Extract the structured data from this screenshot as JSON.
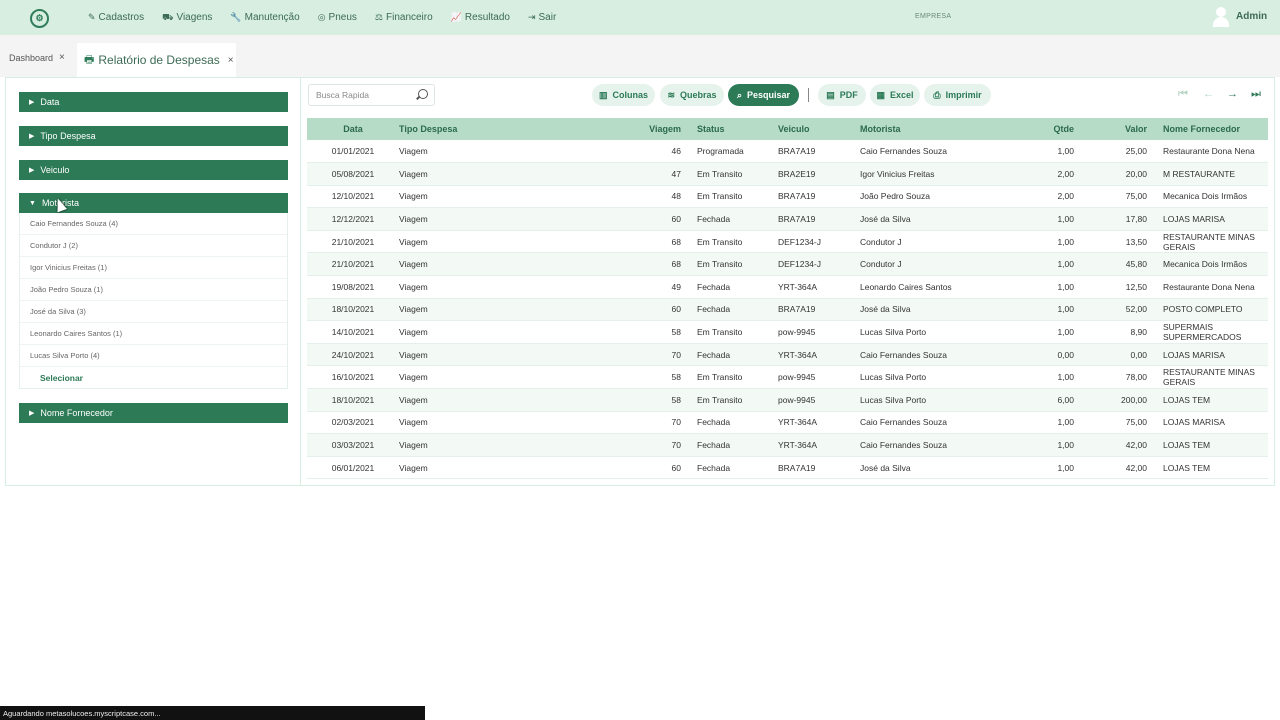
{
  "nav": {
    "logo": "⚙",
    "items": [
      {
        "icon": "✎",
        "icon_name": "edit-icon",
        "label": "Cadastros"
      },
      {
        "icon": "⛟",
        "icon_name": "truck-icon",
        "label": "Viagens"
      },
      {
        "icon": "🔧",
        "icon_name": "wrench-icon",
        "label": "Manutenção"
      },
      {
        "icon": "◎",
        "icon_name": "tire-icon",
        "label": "Pneus"
      },
      {
        "icon": "⚖",
        "icon_name": "money-icon",
        "label": "Financeiro"
      },
      {
        "icon": "📈",
        "icon_name": "chart-icon",
        "label": "Resultado"
      },
      {
        "icon": "⇥",
        "icon_name": "logout-icon",
        "label": "Sair"
      }
    ],
    "empresa": "EMPRESA",
    "user": "Admin"
  },
  "tabs": {
    "dashboard": "Dashboard",
    "active": "Relatório de Despesas",
    "close": "×"
  },
  "filters": {
    "data": "Data",
    "tipo": "Tipo Despesa",
    "veiculo": "Veiculo",
    "motorista": "Motorista",
    "fornecedor": "Nome Fornecedor",
    "motoristas": [
      "Caio Fernandes Souza (4)",
      "Condutor J (2)",
      "Igor Vinicius Freitas (1)",
      "João Pedro Souza (1)",
      "José da Silva (3)",
      "Leonardo Caires Santos (1)",
      "Lucas Silva Porto (4)"
    ],
    "selecionar": "Selecionar"
  },
  "toolbar": {
    "search_placeholder": "Busca Rapida",
    "colunas": "Colunas",
    "quebras": "Quebras",
    "pesquisar": "Pesquisar",
    "pdf": "PDF",
    "excel": "Excel",
    "imprimir": "Imprimir"
  },
  "table": {
    "headers": [
      "Data",
      "Tipo Despesa",
      "Viagem",
      "Status",
      "Veiculo",
      "Motorista",
      "Qtde",
      "Valor",
      "Nome Fornecedor"
    ],
    "rows": [
      [
        "01/01/2021",
        "Viagem",
        "46",
        "Programada",
        "BRA7A19",
        "Caio Fernandes Souza",
        "1,00",
        "25,00",
        "Restaurante Dona Nena"
      ],
      [
        "05/08/2021",
        "Viagem",
        "47",
        "Em Transito",
        "BRA2E19",
        "Igor Vinicius Freitas",
        "2,00",
        "20,00",
        "M RESTAURANTE"
      ],
      [
        "12/10/2021",
        "Viagem",
        "48",
        "Em Transito",
        "BRA7A19",
        "João Pedro Souza",
        "2,00",
        "75,00",
        "Mecanica Dois Irmãos"
      ],
      [
        "12/12/2021",
        "Viagem",
        "60",
        "Fechada",
        "BRA7A19",
        "José da Silva",
        "1,00",
        "17,80",
        "LOJAS MARISA"
      ],
      [
        "21/10/2021",
        "Viagem",
        "68",
        "Em Transito",
        "DEF1234-J",
        "Condutor J",
        "1,00",
        "13,50",
        "RESTAURANTE MINAS GERAIS"
      ],
      [
        "21/10/2021",
        "Viagem",
        "68",
        "Em Transito",
        "DEF1234-J",
        "Condutor J",
        "1,00",
        "45,80",
        "Mecanica Dois Irmãos"
      ],
      [
        "19/08/2021",
        "Viagem",
        "49",
        "Fechada",
        "YRT-364A",
        "Leonardo Caires Santos",
        "1,00",
        "12,50",
        "Restaurante Dona Nena"
      ],
      [
        "18/10/2021",
        "Viagem",
        "60",
        "Fechada",
        "BRA7A19",
        "José da Silva",
        "1,00",
        "52,00",
        "POSTO COMPLETO"
      ],
      [
        "14/10/2021",
        "Viagem",
        "58",
        "Em Transito",
        "pow-9945",
        "Lucas Silva Porto",
        "1,00",
        "8,90",
        "SUPERMAIS SUPERMERCADOS"
      ],
      [
        "24/10/2021",
        "Viagem",
        "70",
        "Fechada",
        "YRT-364A",
        "Caio Fernandes Souza",
        "0,00",
        "0,00",
        "LOJAS MARISA"
      ],
      [
        "16/10/2021",
        "Viagem",
        "58",
        "Em Transito",
        "pow-9945",
        "Lucas Silva Porto",
        "1,00",
        "78,00",
        "RESTAURANTE MINAS GERAIS"
      ],
      [
        "18/10/2021",
        "Viagem",
        "58",
        "Em Transito",
        "pow-9945",
        "Lucas Silva Porto",
        "6,00",
        "200,00",
        "LOJAS TEM"
      ],
      [
        "02/03/2021",
        "Viagem",
        "70",
        "Fechada",
        "YRT-364A",
        "Caio Fernandes Souza",
        "1,00",
        "75,00",
        "LOJAS MARISA"
      ],
      [
        "03/03/2021",
        "Viagem",
        "70",
        "Fechada",
        "YRT-364A",
        "Caio Fernandes Souza",
        "1,00",
        "42,00",
        "LOJAS TEM"
      ],
      [
        "06/01/2021",
        "Viagem",
        "60",
        "Fechada",
        "BRA7A19",
        "José da Silva",
        "1,00",
        "42,00",
        "LOJAS TEM"
      ]
    ]
  },
  "statusbar": "Aguardando metasolucoes.myscriptcase.com...",
  "colors": {
    "accent": "#2c7a56",
    "nav_bg": "#d7eee0",
    "header_bg": "#b6dcc8"
  }
}
